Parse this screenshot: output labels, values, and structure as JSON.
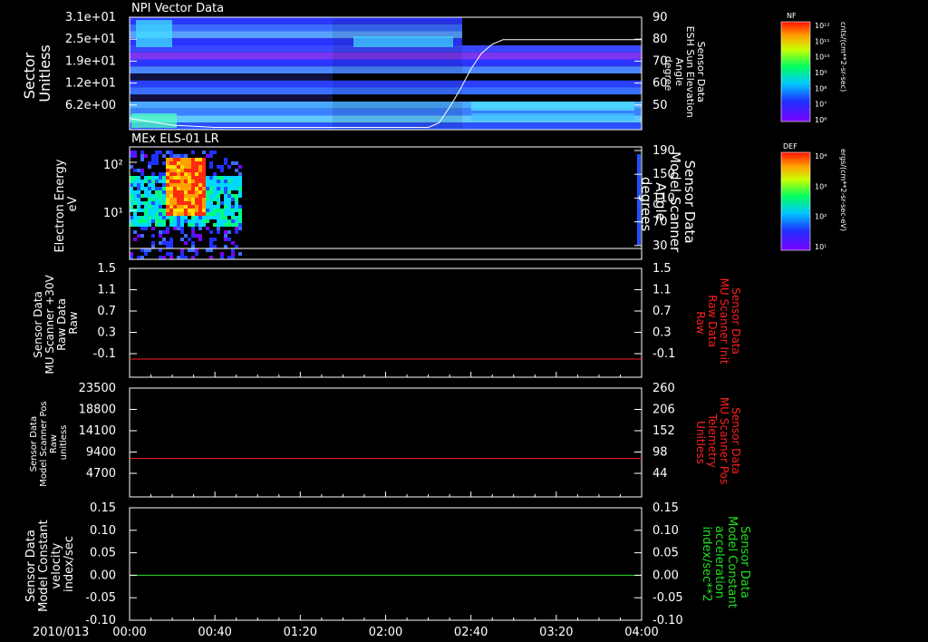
{
  "chart_data": [
    {
      "type": "heatmap",
      "title": "NPI Vector Data",
      "ylabel_left": [
        "Sector",
        "Unitless"
      ],
      "ylabel_right": [
        "Sensor Data",
        "ESH Sun Elevation",
        "Angle",
        "degree"
      ],
      "yticks_left": [
        "3.1e+01",
        "2.5e+01",
        "1.9e+01",
        "1.2e+01",
        "6.2e+00"
      ],
      "yticks_right": [
        "90",
        "80",
        "70",
        "60",
        "50"
      ],
      "ylim_right": [
        40,
        90
      ],
      "colorbar": {
        "label": "NF",
        "units": "cnts/(cm**2-sr-sec)",
        "ticks": [
          "10¹²",
          "10¹¹",
          "10¹⁰",
          "10⁹",
          "10⁸",
          "10⁷",
          "10⁶"
        ]
      },
      "line": {
        "name": "ESH Sun Elevation Angle",
        "x_minutes": [
          0,
          20,
          40,
          60,
          80,
          100,
          120,
          140,
          145,
          150,
          155,
          160,
          165,
          170,
          175,
          180,
          200,
          220,
          240
        ],
        "y": [
          45,
          42,
          41,
          41,
          41,
          41,
          41,
          41,
          43,
          50,
          58,
          67,
          74,
          78,
          80,
          80,
          80,
          80,
          80
        ]
      }
    },
    {
      "type": "heatmap",
      "title": "MEx ELS-01 LR",
      "ylabel_left": [
        "Electron Energy",
        "eV"
      ],
      "ylabel_right": [
        "Sensor Data",
        "Model Scanner",
        "Angle",
        "degrees"
      ],
      "yticks_left": [
        "10²",
        "10¹"
      ],
      "yticks_right": [
        "190",
        "150",
        "110",
        "70",
        "30"
      ],
      "ylim_right": [
        10,
        190
      ],
      "colorbar": {
        "label": "DEF",
        "units": "ergs/(cm**2-sr-sec-eV)",
        "ticks": [
          "10⁴",
          "10³",
          "10²",
          "10¹"
        ]
      },
      "line": {
        "name": "Model Scanner Angle",
        "x_minutes": [
          0,
          240
        ],
        "y": [
          10,
          10
        ]
      }
    },
    {
      "type": "line",
      "ylabel_left": [
        "Sensor Data",
        "MU Scanner +30V",
        "Raw Data",
        "Raw"
      ],
      "ylabel_right": [
        "Sensor Data",
        "MU Scanner Init",
        "Raw Data",
        "Raw"
      ],
      "yticks_left": [
        "1.5",
        "1.1",
        "0.7",
        "0.3",
        "-0.1"
      ],
      "yticks_right": [
        "1.5",
        "1.1",
        "0.7",
        "0.3",
        "-0.1"
      ],
      "ylim": [
        -0.3,
        1.5
      ],
      "series": [
        {
          "color": "#ff2020",
          "x_minutes": [
            0,
            240
          ],
          "y": [
            0.0,
            0.0
          ]
        }
      ]
    },
    {
      "type": "line",
      "ylabel_left": [
        "Sensor Data",
        "Model Scanner Pos",
        "Raw",
        "unitless"
      ],
      "ylabel_right": [
        "Sensor Data",
        "MU Scanner Pos",
        "Telemetry",
        "Unitless"
      ],
      "yticks_left": [
        "23500",
        "18800",
        "14100",
        "9400",
        "4700"
      ],
      "yticks_right": [
        "260",
        "206",
        "152",
        "98",
        "44"
      ],
      "ylim": [
        0,
        23500
      ],
      "series": [
        {
          "color": "#ff2020",
          "x_minutes": [
            0,
            240
          ],
          "y": [
            8300,
            8300
          ]
        }
      ]
    },
    {
      "type": "line",
      "ylabel_left": [
        "Sensor Data",
        "Model Constant",
        "velocity",
        "index/sec"
      ],
      "ylabel_right": [
        "Sensor Data",
        "Model Constant",
        "acceleration",
        "index/sec**2"
      ],
      "yticks_left": [
        "0.15",
        "0.10",
        "0.05",
        "0.00",
        "-0.05",
        "-0.10"
      ],
      "yticks_right": [
        "0.15",
        "0.10",
        "0.05",
        "0.00",
        "-0.05",
        "-0.10"
      ],
      "ylim": [
        -0.1,
        0.15
      ],
      "series": [
        {
          "color": "#20e020",
          "x_minutes": [
            0,
            240
          ],
          "y": [
            0.0,
            0.0
          ]
        }
      ]
    }
  ],
  "x_axis": {
    "date_label": "2010/013",
    "ticks": [
      "00:00",
      "00:40",
      "01:20",
      "02:00",
      "02:40",
      "03:20",
      "04:00"
    ],
    "xlim_minutes": [
      0,
      240
    ]
  },
  "colors": {
    "right_label_panel3": "#ff2020",
    "right_label_panel4": "#ff2020",
    "right_label_panel5": "#20e020"
  }
}
